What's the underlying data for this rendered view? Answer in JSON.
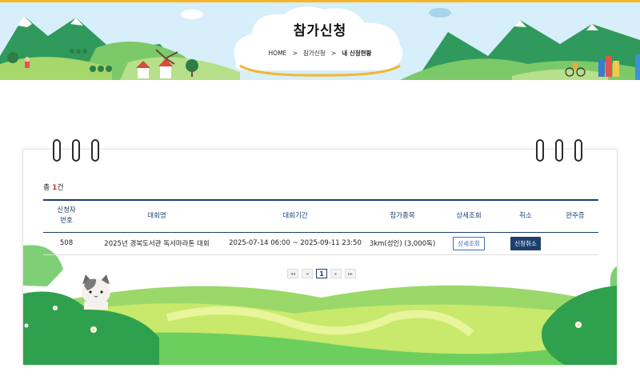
{
  "banner": {
    "title": "참가신청",
    "breadcrumb": [
      "HOME",
      "참가신청",
      "내 신청현황"
    ],
    "separator": ">"
  },
  "summary": {
    "prefix": "총",
    "count": "1",
    "suffix": "건"
  },
  "table": {
    "headers": [
      "신청자\n번호",
      "대회명",
      "대회기간",
      "참가종목",
      "상세조회",
      "취소",
      "완주증"
    ],
    "rows": [
      {
        "number": "508",
        "name": "2025년 경북도서관 독서마라톤 대회",
        "period": "2025-07-14 06:00 ~ 2025-09-11 23:50",
        "event": "3km(성인) (3,000독)",
        "detail_label": "상세조회",
        "cancel_label": "신청취소",
        "certificate": ""
      }
    ]
  },
  "pagination": {
    "first": "◂◂",
    "prev": "◂",
    "current": "1",
    "next": "▸",
    "last": "▸▸"
  },
  "colors": {
    "primary": "#1d3f6e",
    "accent_red": "#d62b2b",
    "top_strip": "#f5b52b",
    "sky": "#d7effa"
  }
}
